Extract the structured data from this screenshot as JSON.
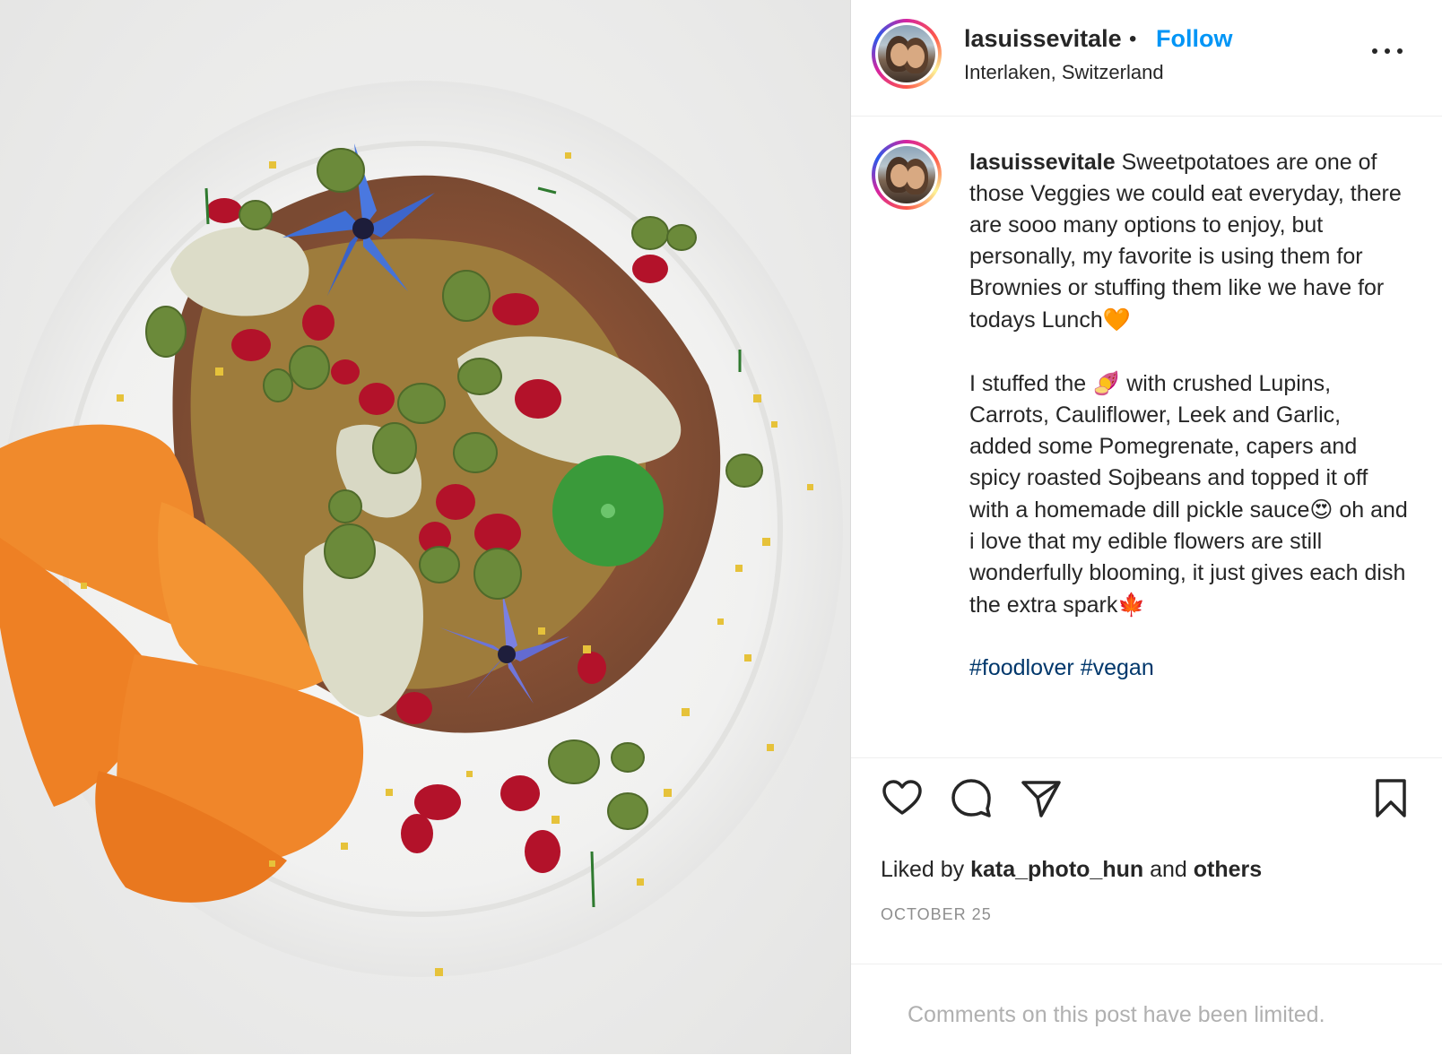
{
  "photo": {
    "description_icon": "food-photo"
  },
  "header": {
    "username": "lasuissevitale",
    "separator": "•",
    "follow_label": "Follow",
    "location": "Interlaken, Switzerland",
    "more_icon": "more-horizontal-icon"
  },
  "caption": {
    "username": "lasuissevitale",
    "paragraph1": "Sweetpotatoes are one of those Veggies we could eat everyday, there are sooo many options to enjoy, but personally, my favorite is using them for Brownies or stuffing them like we have for todays Lunch",
    "emoji1": "🧡",
    "paragraph2_part1": "I stuffed the ",
    "emoji2": "🍠",
    "paragraph2_part2": " with crushed Lupins, Carrots, Cauliflower, Leek and Garlic, added some Pomegrenate, capers and spicy roasted Sojbeans and topped it off with a homemade dill pickle sauce",
    "emoji3": "😍",
    "paragraph2_part3": " oh and i love that my edible flowers are still wonderfully blooming, it just gives each dish the extra spark",
    "emoji4": "🍁",
    "hashtags": [
      "#foodlover",
      "#vegan"
    ]
  },
  "actions": {
    "like_icon": "heart-icon",
    "comment_icon": "comment-icon",
    "share_icon": "share-icon",
    "save_icon": "bookmark-icon"
  },
  "likes": {
    "prefix": "Liked by ",
    "user": "kata_photo_hun",
    "middle": " and ",
    "others": "others"
  },
  "date": "OCTOBER 25",
  "comments_notice": "Comments on this post have been limited.",
  "colors": {
    "accent": "#0095f6",
    "text": "#262626",
    "muted": "#8e8e8e",
    "hashtag": "#00376b"
  }
}
